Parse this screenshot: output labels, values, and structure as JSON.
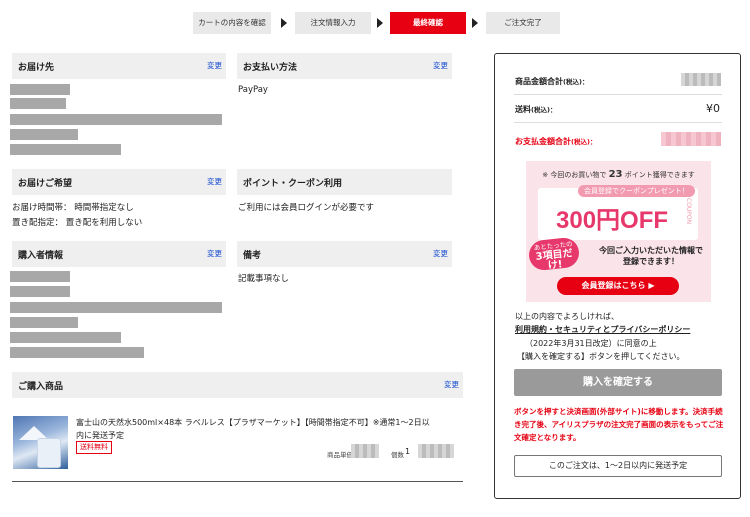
{
  "steps": [
    {
      "label": "カートの内容を確認",
      "active": false
    },
    {
      "label": "注文情報入力",
      "active": false
    },
    {
      "label": "最終確認",
      "active": true
    },
    {
      "label": "ご注文完了",
      "active": false
    }
  ],
  "change_label": "変更",
  "delivery_address": {
    "title": "お届け先"
  },
  "payment": {
    "title": "お支払い方法",
    "value": "PayPay"
  },
  "delivery_wish": {
    "title": "お届けご希望",
    "time_line": "お届け時間帯： 時間帯指定なし",
    "place_line": "置き配指定： 置き配を利用しない"
  },
  "points": {
    "title": "ポイント・クーポン利用",
    "value": "ご利用には会員ログインが必要です"
  },
  "buyer": {
    "title": "購入者情報"
  },
  "notes": {
    "title": "備考",
    "value": "記載事項なし"
  },
  "products": {
    "title": "ご購入商品",
    "items": [
      {
        "name_line1": "富士山の天然水500ml×48本 ラベルレス【プラザマーケット】【時間帯指定不可】※通常1〜2日以",
        "name_line2": "内に発送予定",
        "badge": "送料無料",
        "price_label": "商品単価",
        "qty_label": "個数",
        "qty": "1"
      }
    ]
  },
  "summary": {
    "subtotal_label": "商品金額合計",
    "subtotal_tax": "(税込)：",
    "shipping_label": "送料",
    "shipping_tax": "(税込)：",
    "shipping_value": "¥0",
    "total_label": "お支払金額合計",
    "total_tax": "(税込)：",
    "banner": {
      "top_text_pre": "※ 今回のお買い物で",
      "points_num": "23",
      "top_text_post": "ポイント獲得できます",
      "coupon_tag": "会員登録でクーポンプレゼント！",
      "coupon_amount": "300円OFF",
      "coupon_side": "COUPON",
      "bubble_line1": "あとたったの",
      "bubble_line2": "3項目だけ!",
      "info_line1": "今回ご入力いただいた情報で",
      "info_line2": "登録できます！",
      "button": "会員登録はこちら ▶"
    },
    "confirm_line1": "以上の内容でよろしければ、",
    "confirm_link": "利用規約・セキュリティとプライバシーポリシー",
    "confirm_line3": "（2022年3月31日改定）に同意の上",
    "confirm_line4": "【購入を確定する】ボタンを押してください。",
    "confirm_button": "購入を確定する",
    "warning": "ボタンを押すと決済画面(外部サイト)に移動します。決済手続き完了後、アイリスプラザの注文完了画面の表示をもってご注文確定となります。",
    "shipping_note": "このご注文は、1〜2日以内に発送予定"
  },
  "colors": {
    "accent": "#e60012",
    "link": "#1a4fd0",
    "header_bg": "#efefef"
  }
}
